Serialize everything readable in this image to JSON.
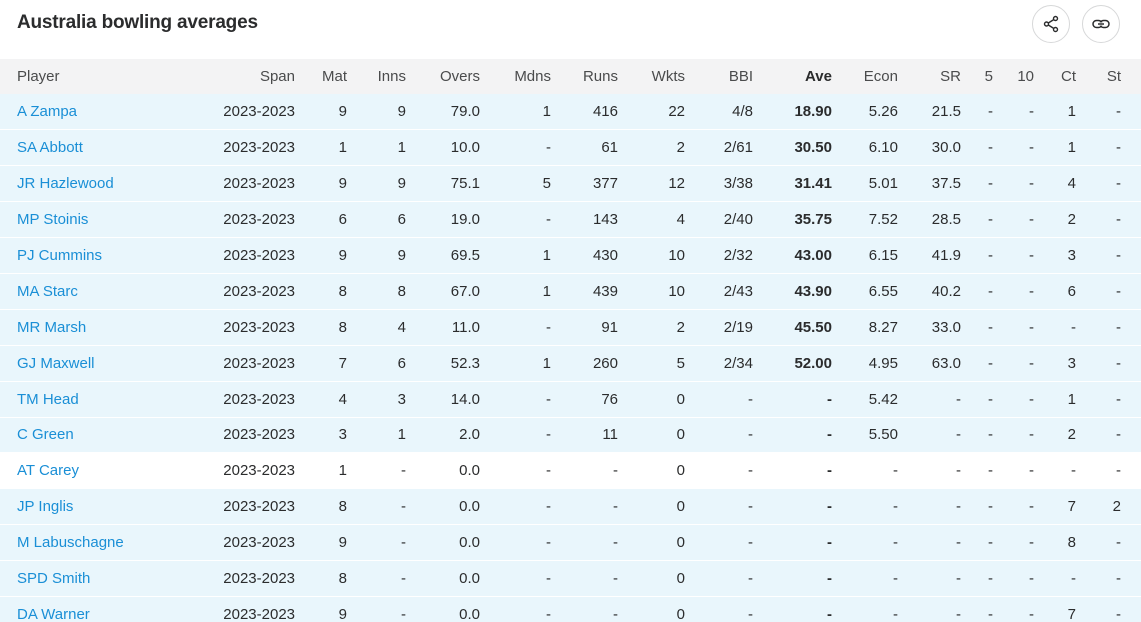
{
  "title": "Australia bowling averages",
  "actions": {
    "share_icon": "share-icon",
    "link_icon": "link-icon"
  },
  "table": {
    "headers": [
      "Player",
      "Span",
      "Mat",
      "Inns",
      "Overs",
      "Mdns",
      "Runs",
      "Wkts",
      "BBI",
      "Ave",
      "Econ",
      "SR",
      "5",
      "10",
      "Ct",
      "St"
    ],
    "rows": [
      [
        "A Zampa",
        "2023-2023",
        "9",
        "9",
        "79.0",
        "1",
        "416",
        "22",
        "4/8",
        "18.90",
        "5.26",
        "21.5",
        "-",
        "-",
        "1",
        "-"
      ],
      [
        "SA Abbott",
        "2023-2023",
        "1",
        "1",
        "10.0",
        "-",
        "61",
        "2",
        "2/61",
        "30.50",
        "6.10",
        "30.0",
        "-",
        "-",
        "1",
        "-"
      ],
      [
        "JR Hazlewood",
        "2023-2023",
        "9",
        "9",
        "75.1",
        "5",
        "377",
        "12",
        "3/38",
        "31.41",
        "5.01",
        "37.5",
        "-",
        "-",
        "4",
        "-"
      ],
      [
        "MP Stoinis",
        "2023-2023",
        "6",
        "6",
        "19.0",
        "-",
        "143",
        "4",
        "2/40",
        "35.75",
        "7.52",
        "28.5",
        "-",
        "-",
        "2",
        "-"
      ],
      [
        "PJ Cummins",
        "2023-2023",
        "9",
        "9",
        "69.5",
        "1",
        "430",
        "10",
        "2/32",
        "43.00",
        "6.15",
        "41.9",
        "-",
        "-",
        "3",
        "-"
      ],
      [
        "MA Starc",
        "2023-2023",
        "8",
        "8",
        "67.0",
        "1",
        "439",
        "10",
        "2/43",
        "43.90",
        "6.55",
        "40.2",
        "-",
        "-",
        "6",
        "-"
      ],
      [
        "MR Marsh",
        "2023-2023",
        "8",
        "4",
        "11.0",
        "-",
        "91",
        "2",
        "2/19",
        "45.50",
        "8.27",
        "33.0",
        "-",
        "-",
        "-",
        "-"
      ],
      [
        "GJ Maxwell",
        "2023-2023",
        "7",
        "6",
        "52.3",
        "1",
        "260",
        "5",
        "2/34",
        "52.00",
        "4.95",
        "63.0",
        "-",
        "-",
        "3",
        "-"
      ],
      [
        "TM Head",
        "2023-2023",
        "4",
        "3",
        "14.0",
        "-",
        "76",
        "0",
        "-",
        "-",
        "5.42",
        "-",
        "-",
        "-",
        "1",
        "-"
      ],
      [
        "C Green",
        "2023-2023",
        "3",
        "1",
        "2.0",
        "-",
        "11",
        "0",
        "-",
        "-",
        "5.50",
        "-",
        "-",
        "-",
        "2",
        "-"
      ],
      [
        "AT Carey",
        "2023-2023",
        "1",
        "-",
        "0.0",
        "-",
        "-",
        "0",
        "-",
        "-",
        "-",
        "-",
        "-",
        "-",
        "-",
        "-"
      ],
      [
        "JP Inglis",
        "2023-2023",
        "8",
        "-",
        "0.0",
        "-",
        "-",
        "0",
        "-",
        "-",
        "-",
        "-",
        "-",
        "-",
        "7",
        "2"
      ],
      [
        "M Labuschagne",
        "2023-2023",
        "9",
        "-",
        "0.0",
        "-",
        "-",
        "0",
        "-",
        "-",
        "-",
        "-",
        "-",
        "-",
        "8",
        "-"
      ],
      [
        "SPD Smith",
        "2023-2023",
        "8",
        "-",
        "0.0",
        "-",
        "-",
        "0",
        "-",
        "-",
        "-",
        "-",
        "-",
        "-",
        "-",
        "-"
      ],
      [
        "DA Warner",
        "2023-2023",
        "9",
        "-",
        "0.0",
        "-",
        "-",
        "0",
        "-",
        "-",
        "-",
        "-",
        "-",
        "-",
        "7",
        "-"
      ]
    ],
    "plain_rows": [
      10
    ]
  },
  "colors": {
    "link": "#1a8fd6",
    "row_highlight": "#e9f6fc",
    "header_bg": "#f3f3f4",
    "text": "#2b2c2d"
  }
}
